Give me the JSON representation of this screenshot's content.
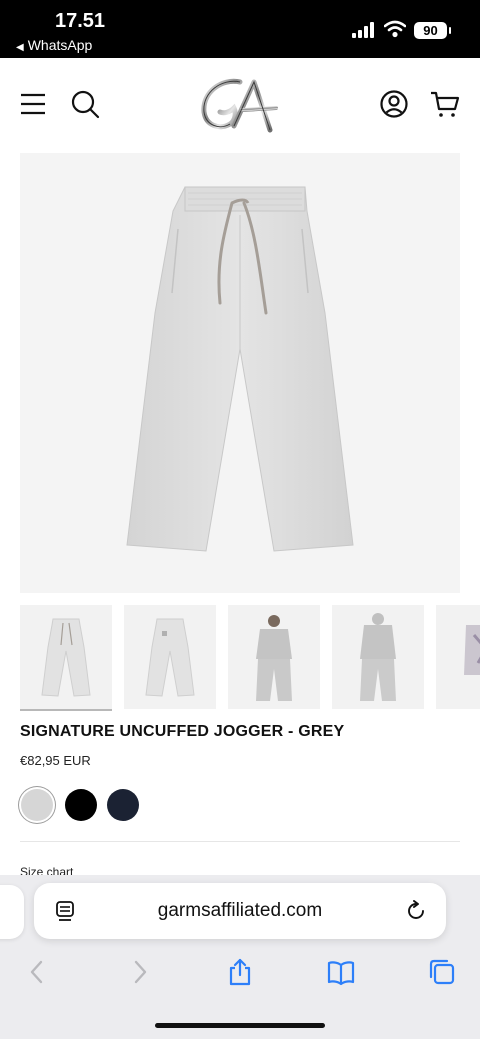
{
  "status_bar": {
    "time": "17.51",
    "back_app": "WhatsApp",
    "battery": "90"
  },
  "header": {
    "logo_text": "GA",
    "menu_icon": "hamburger-menu-icon",
    "search_icon": "search-icon",
    "account_icon": "account-icon",
    "cart_icon": "cart-icon"
  },
  "product": {
    "title": "SIGNATURE UNCUFFED JOGGER - GREY",
    "price": "€82,95 EUR",
    "main_color": "#dedede",
    "colors": [
      "#d6d6d6",
      "#000000",
      "#1b2233"
    ],
    "selected_color_index": 0,
    "size_chart_label": "Size chart",
    "thumbnails": [
      "jogger-front",
      "jogger-back",
      "model-front",
      "model-back",
      "model-side"
    ]
  },
  "browser": {
    "url": "garmsaffiliated.com",
    "accent": "#2d7ff9"
  }
}
